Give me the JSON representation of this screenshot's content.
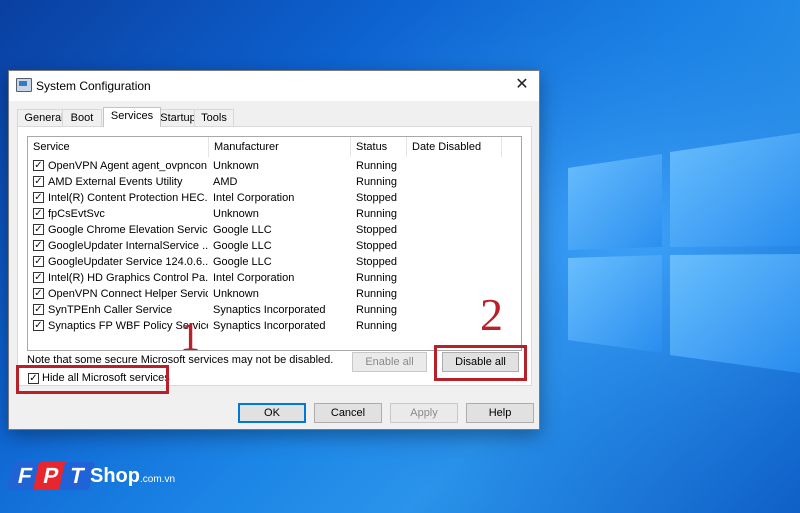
{
  "desktop": {
    "background_color": "#1576d9",
    "logo_color": "#3fa0ff"
  },
  "dialog": {
    "title": "System Configuration",
    "close_symbol": "✕",
    "tabs": [
      {
        "label": "General"
      },
      {
        "label": "Boot"
      },
      {
        "label": "Services",
        "active": true
      },
      {
        "label": "Startup"
      },
      {
        "label": "Tools"
      }
    ],
    "list": {
      "columns": [
        "Service",
        "Manufacturer",
        "Status",
        "Date Disabled"
      ],
      "rows": [
        {
          "checked": true,
          "service": "OpenVPN Agent agent_ovpncon...",
          "manufacturer": "Unknown",
          "status": "Running",
          "date_disabled": ""
        },
        {
          "checked": true,
          "service": "AMD External Events Utility",
          "manufacturer": "AMD",
          "status": "Running",
          "date_disabled": ""
        },
        {
          "checked": true,
          "service": "Intel(R) Content Protection HEC...",
          "manufacturer": "Intel Corporation",
          "status": "Stopped",
          "date_disabled": ""
        },
        {
          "checked": true,
          "service": "fpCsEvtSvc",
          "manufacturer": "Unknown",
          "status": "Running",
          "date_disabled": ""
        },
        {
          "checked": true,
          "service": "Google Chrome Elevation Servic...",
          "manufacturer": "Google LLC",
          "status": "Stopped",
          "date_disabled": ""
        },
        {
          "checked": true,
          "service": "GoogleUpdater InternalService ...",
          "manufacturer": "Google LLC",
          "status": "Stopped",
          "date_disabled": ""
        },
        {
          "checked": true,
          "service": "GoogleUpdater Service 124.0.6...",
          "manufacturer": "Google LLC",
          "status": "Stopped",
          "date_disabled": ""
        },
        {
          "checked": true,
          "service": "Intel(R) HD Graphics Control Pa...",
          "manufacturer": "Intel Corporation",
          "status": "Running",
          "date_disabled": ""
        },
        {
          "checked": true,
          "service": "OpenVPN Connect Helper Service",
          "manufacturer": "Unknown",
          "status": "Running",
          "date_disabled": ""
        },
        {
          "checked": true,
          "service": "SynTPEnh Caller Service",
          "manufacturer": "Synaptics Incorporated",
          "status": "Running",
          "date_disabled": ""
        },
        {
          "checked": true,
          "service": "Synaptics FP WBF Policy Service",
          "manufacturer": "Synaptics Incorporated",
          "status": "Running",
          "date_disabled": ""
        }
      ]
    },
    "note": "Note that some secure Microsoft services may not be disabled.",
    "enable_all": "Enable all",
    "disable_all": "Disable all",
    "hide_ms": {
      "label": "Hide all Microsoft services",
      "checked": true
    },
    "buttons": {
      "ok": "OK",
      "cancel": "Cancel",
      "apply": "Apply",
      "help": "Help"
    }
  },
  "annotations": {
    "marker1": "1",
    "marker2": "2",
    "highlight_color": "#b8202a"
  },
  "branding": {
    "letters": [
      "F",
      "P",
      "T"
    ],
    "letter_colors": [
      "#1f63d6",
      "#e8262d",
      "#1f63d6"
    ],
    "shop": "Shop",
    "domain": ".com.vn"
  }
}
